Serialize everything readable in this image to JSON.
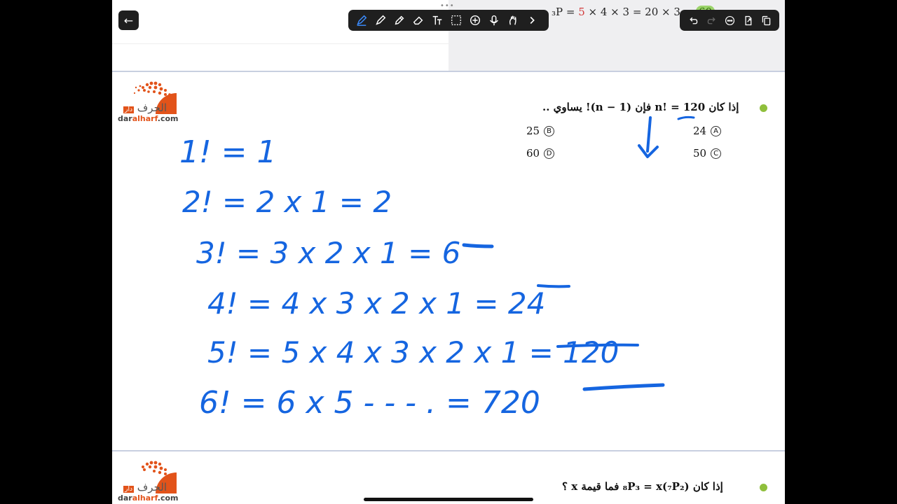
{
  "toolbar": {
    "tools": [
      "pen-icon",
      "marker-icon",
      "highlighter-icon",
      "eraser-icon",
      "text-icon",
      "lasso-icon",
      "add-icon",
      "mic-icon",
      "gesture-icon",
      "chevron-right-icon"
    ],
    "right_tools": [
      "undo-icon",
      "redo-icon",
      "more-icon",
      "export-icon",
      "copy-icon"
    ],
    "accent": "#3b8cff"
  },
  "top_formula": {
    "prefix": "₃P = ",
    "hl": "5",
    "middle": " × 4 × 3 = 20 × 3 = ",
    "result": "60"
  },
  "logo": {
    "arabic": "الحرف",
    "arabic_small": "دار",
    "english_pre": "dar",
    "english_mid": "alharf",
    "english_suffix": ".com"
  },
  "question1": {
    "text": "إذا كان n! = 120 فإن (n − 1)! يساوي ..",
    "options": [
      {
        "letter": "A",
        "value": "24"
      },
      {
        "letter": "B",
        "value": "25"
      },
      {
        "letter": "C",
        "value": "50"
      },
      {
        "letter": "D",
        "value": "60"
      }
    ]
  },
  "question2": {
    "text": "إذا كان ₈P₃ = x(₇P₂) فما قيمة x ؟"
  },
  "handwriting": {
    "lines": [
      "1! = 1",
      "2! = 2 x 1 = 2",
      "3! = 3 x 2 x 1 = 6",
      "4! = 4 x 3 x 2 x 1 = 24",
      "5! = 5 x 4 x 3 x 2 x 1 = 120",
      "6! = 6 x 5 - - - . = 720"
    ]
  },
  "colors": {
    "ink": "#1565e0",
    "bullet": "#8fbf3c",
    "brand": "#e2531a"
  }
}
